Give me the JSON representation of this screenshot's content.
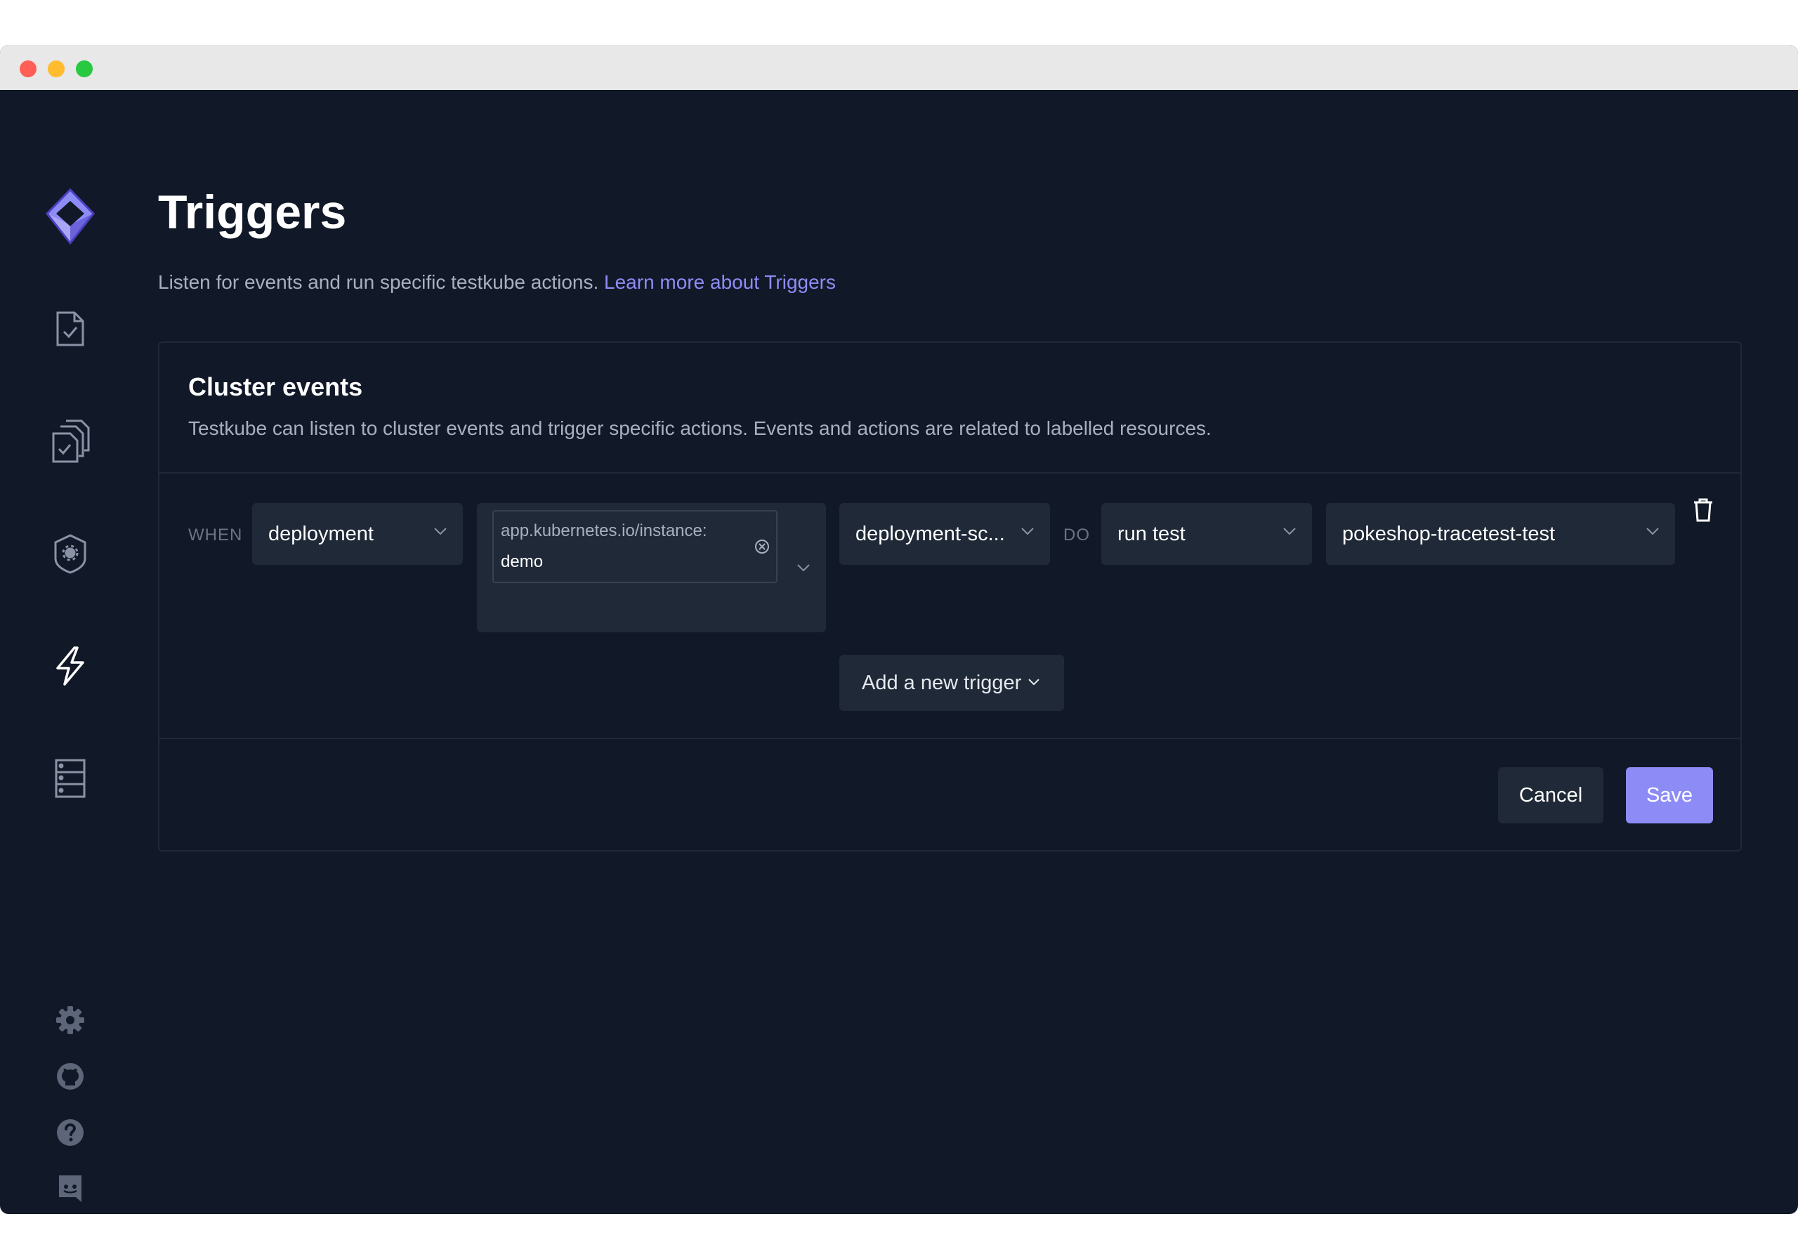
{
  "window": {
    "title_buttons": [
      "close",
      "minimize",
      "zoom"
    ]
  },
  "sidebar": {
    "logo": "testkube-logo-icon",
    "items": [
      {
        "icon": "test-file-icon",
        "active": false
      },
      {
        "icon": "test-suites-icon",
        "active": false
      },
      {
        "icon": "executors-shield-icon",
        "active": false
      },
      {
        "icon": "triggers-bolt-icon",
        "active": true
      },
      {
        "icon": "sources-icon",
        "active": false
      }
    ],
    "bottom": [
      {
        "icon": "gear-icon"
      },
      {
        "icon": "github-icon"
      },
      {
        "icon": "help-icon"
      },
      {
        "icon": "discord-icon"
      }
    ]
  },
  "page": {
    "title": "Triggers",
    "description": "Listen for events and run specific testkube actions.",
    "learn_more": "Learn more about Triggers"
  },
  "card": {
    "title": "Cluster events",
    "subtitle": "Testkube can listen to cluster events and trigger specific actions. Events and actions are related to labelled resources."
  },
  "trigger": {
    "when_label": "WHEN",
    "resource": "deployment",
    "selector_key": "app.kubernetes.io/instance:",
    "selector_value": "demo",
    "event": "deployment-sc...",
    "do_label": "DO",
    "action": "run test",
    "target": "pokeshop-tracetest-test"
  },
  "actions": {
    "add_trigger": "Add a new trigger",
    "cancel": "Cancel",
    "save": "Save"
  },
  "colors": {
    "background": "#111827",
    "surface": "#1f2937",
    "accent": "#8d8cf7",
    "muted_text": "#a8b0c0"
  }
}
